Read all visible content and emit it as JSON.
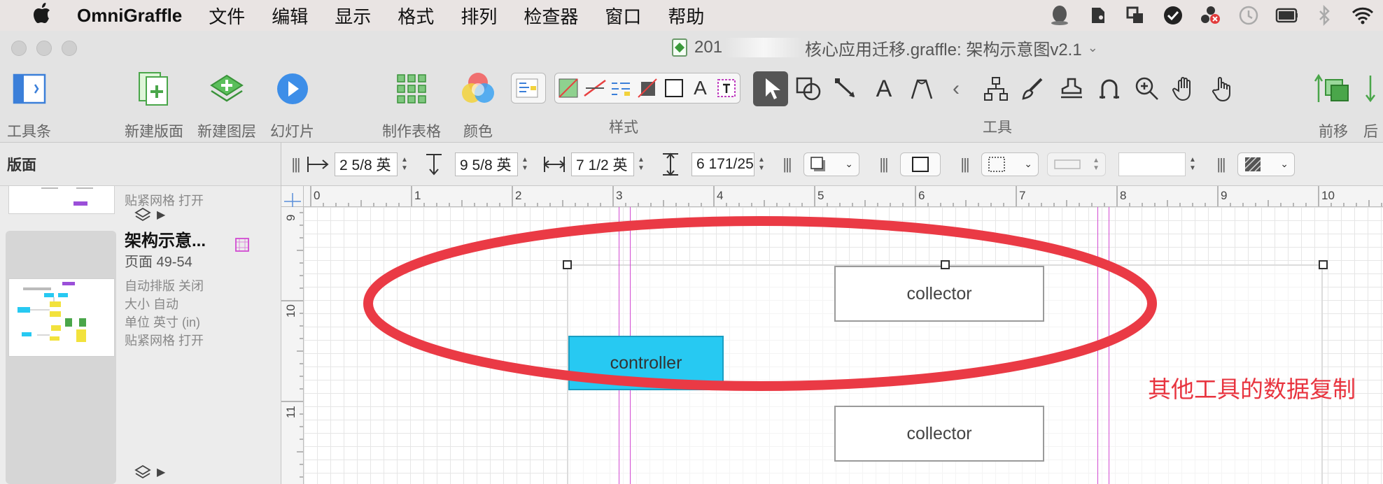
{
  "menubar": {
    "apple": "",
    "app_name": "OmniGraffle",
    "items": [
      "文件",
      "编辑",
      "显示",
      "格式",
      "排列",
      "检查器",
      "窗口",
      "帮助"
    ]
  },
  "window": {
    "title_prefix": "201",
    "title_suffix": "核心应用迁移.graffle: 架构示意图v2.1"
  },
  "toolbar": {
    "toolbar_toggle": "工具条",
    "new_canvas": "新建版面",
    "new_layer": "新建图层",
    "slideshow": "幻灯片",
    "make_table": "制作表格",
    "colors": "颜色",
    "style": "样式",
    "tools": "工具",
    "bring_forward": "前移",
    "next_cut": "后"
  },
  "sidebar": {
    "header": "版面",
    "top_item": {
      "snap_grid": "贴紧网格 打开"
    },
    "item": {
      "name": "架构示意...",
      "pages": "页面 49-54",
      "auto_layout": "自动排版 关闭",
      "size": "大小 自动",
      "units": "单位 英寸 (in)",
      "snap_grid": "贴紧网格 打开"
    }
  },
  "inspector": {
    "x": "2 5/8 英",
    "y": "9 5/8 英",
    "width": "7 1/2 英",
    "height": "6 171/25"
  },
  "rulers": {
    "top": [
      "0",
      "1",
      "2",
      "3",
      "4",
      "5",
      "6",
      "7",
      "8",
      "9",
      "10"
    ],
    "left": [
      "9",
      "10",
      "11"
    ]
  },
  "canvas": {
    "shapes": {
      "collector_top": "collector",
      "controller": "controller",
      "collector_bottom": "collector"
    },
    "annotation": "其他工具的数据复制",
    "colors": {
      "controller_fill": "#27c9f2",
      "ellipse": "#e8343f",
      "guide": "#d24bd2"
    }
  }
}
